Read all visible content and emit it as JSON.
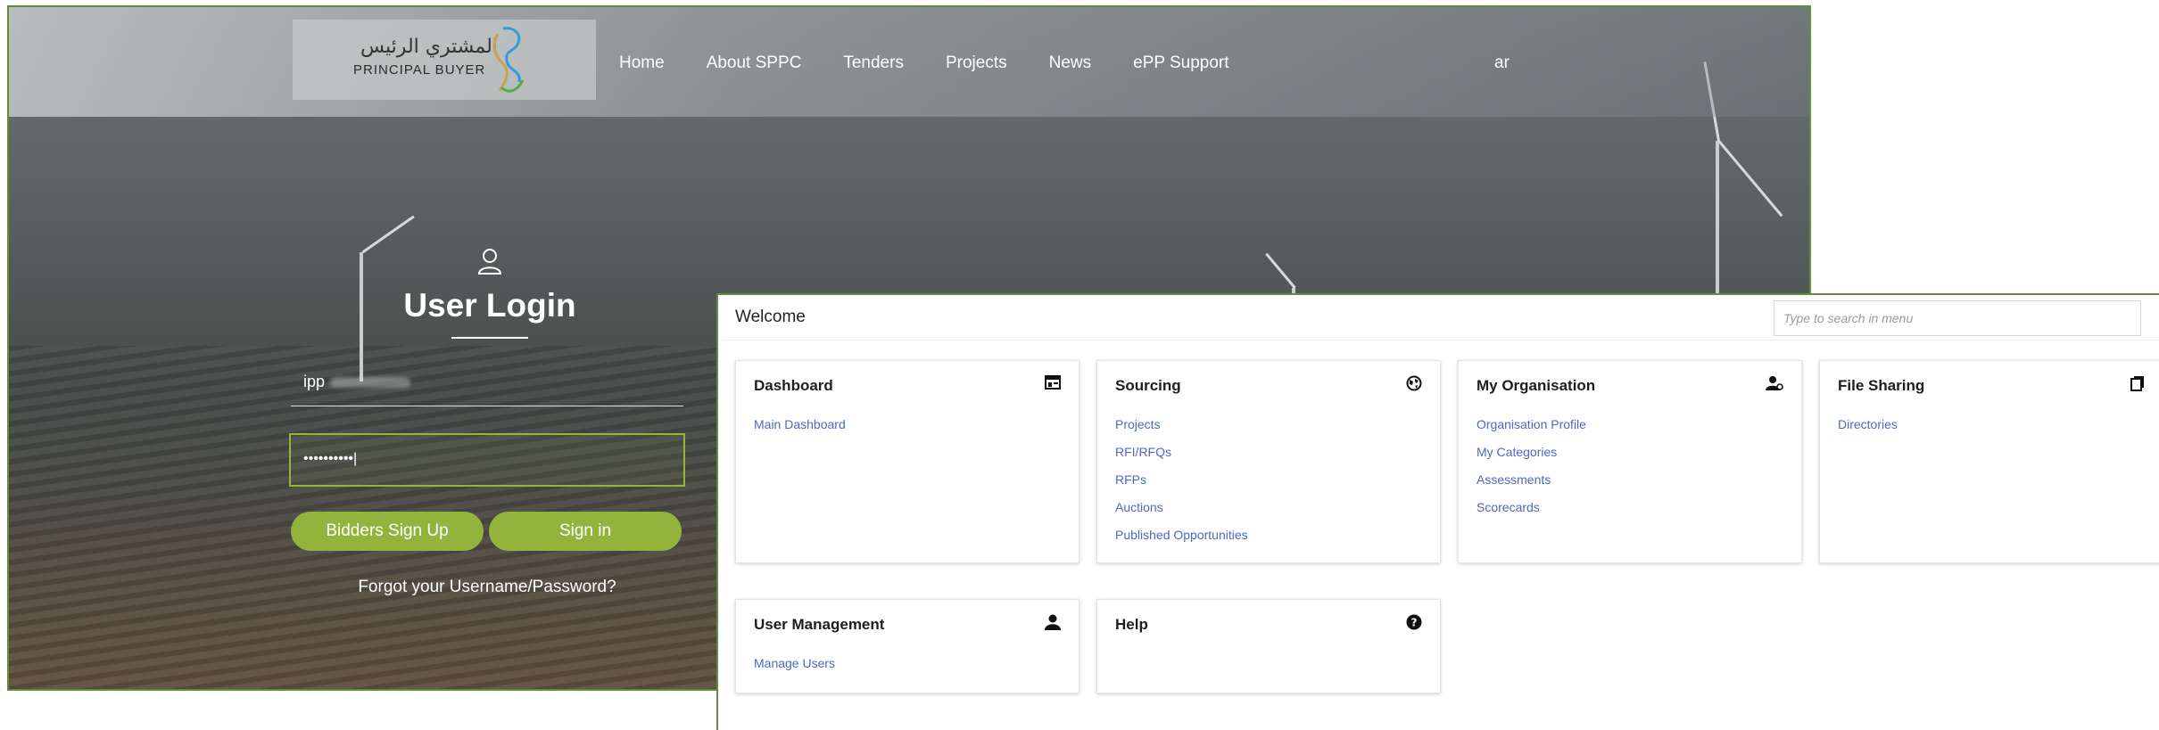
{
  "login": {
    "logo": {
      "arabic": "المشتري الرئيس",
      "english": "PRINCIPAL  BUYER"
    },
    "nav": [
      "Home",
      "About SPPC",
      "Tenders",
      "Projects",
      "News",
      "ePP Support"
    ],
    "lang": "ar",
    "title": "User Login",
    "username_value": "ipp",
    "password_mask": "••••••••••",
    "signup_label": "Bidders Sign Up",
    "signin_label": "Sign in",
    "forgot_label": "Forgot your Username/Password?"
  },
  "welcome": {
    "title": "Welcome",
    "search_placeholder": "Type to search in menu",
    "cards": [
      {
        "title": "Dashboard",
        "icon": "dashboard-icon",
        "links": [
          "Main Dashboard"
        ]
      },
      {
        "title": "Sourcing",
        "icon": "globe-icon",
        "links": [
          "Projects",
          "RFI/RFQs",
          "RFPs",
          "Auctions",
          "Published Opportunities"
        ]
      },
      {
        "title": "My Organisation",
        "icon": "org-user-icon",
        "links": [
          "Organisation Profile",
          "My Categories",
          "Assessments",
          "Scorecards"
        ]
      },
      {
        "title": "File Sharing",
        "icon": "files-icon",
        "links": [
          "Directories"
        ]
      },
      {
        "title": "User Management",
        "icon": "user-icon",
        "links": [
          "Manage Users"
        ]
      },
      {
        "title": "Help",
        "icon": "help-icon",
        "links": []
      }
    ]
  }
}
